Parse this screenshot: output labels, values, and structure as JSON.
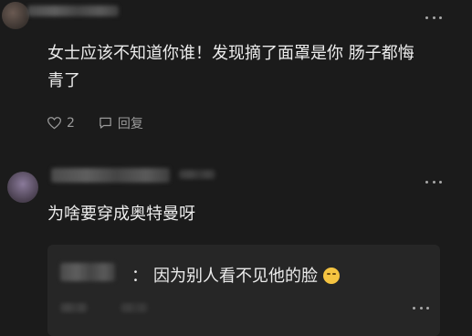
{
  "comment1": {
    "text": "女士应该不知道你谁！发现摘了面罩是你 肠子都悔\n青了",
    "like_count": "2",
    "reply_label": "回复"
  },
  "comment2": {
    "text": "为啥要穿成奥特曼呀"
  },
  "reply": {
    "separator": "：",
    "text": "因为别人看不见他的脸"
  },
  "icons": {
    "like": "heart-icon",
    "reply": "comment-icon",
    "more": "more-dots-icon",
    "emoji": "sweat-smile-emoji"
  }
}
